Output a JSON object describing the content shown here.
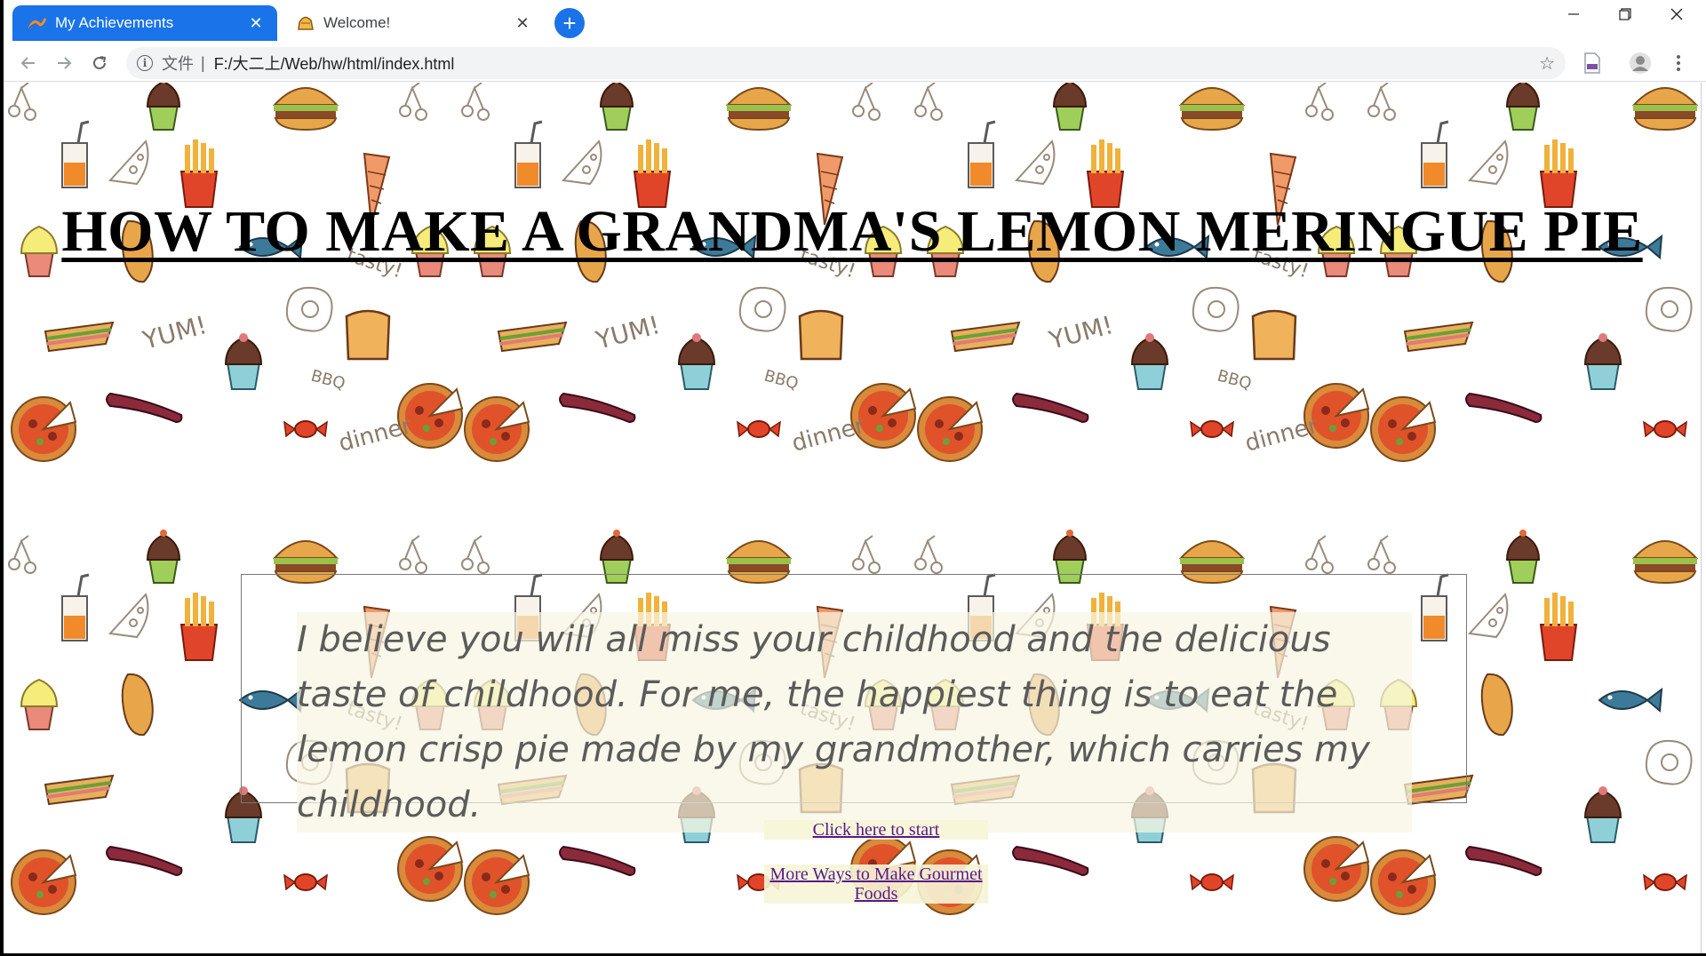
{
  "browser": {
    "tabs": [
      {
        "title": "My Achievements",
        "active": true,
        "favicon": "chart-favicon-icon"
      },
      {
        "title": "Welcome!",
        "active": false,
        "favicon": "pie-favicon-icon"
      }
    ],
    "url_scheme_label": "文件",
    "url_separator": "|",
    "url": "F:/大二上/Web/hw/html/index.html",
    "accent_color": "#1a73e8"
  },
  "page": {
    "title": "HOW TO MAKE A GRANDMA'S LEMON MERINGUE PIE",
    "intro": "I believe you will all miss your childhood and the delicious taste of childhood. For me, the happiest thing is to eat the lemon crisp pie made by my grandmother, which carries my childhood.",
    "links": {
      "start": "Click here to start",
      "more": "More Ways to Make Gourmet Foods"
    },
    "link_color": "#551a8b",
    "background_words": [
      "tasty!",
      "YUM!",
      "BBQ",
      "dinner"
    ]
  }
}
